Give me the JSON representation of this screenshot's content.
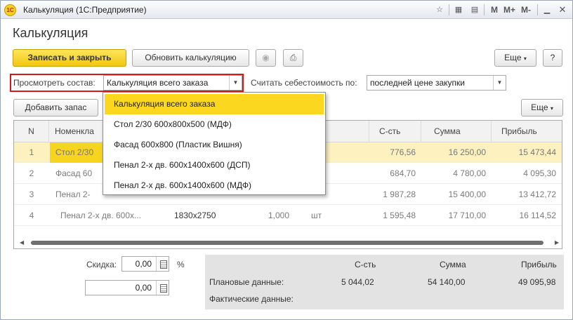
{
  "window": {
    "app_logo": "1С",
    "title": "Калькуляция  (1С:Предприятие)",
    "toolbar": {
      "m": "M",
      "mplus": "M+",
      "mminus": "M-"
    }
  },
  "form": {
    "title": "Калькуляция",
    "buttons": {
      "save_close": "Записать и закрыть",
      "refresh": "Обновить калькуляцию",
      "more": "Еще",
      "help": "?"
    },
    "view_label": "Просмотреть состав:",
    "view_value": "Калькуляция всего заказа",
    "cost_label": "Считать себестоимость по:",
    "cost_value": "последней цене закупки",
    "add_stock": "Добавить запас",
    "more2": "Еще"
  },
  "dropdown": {
    "items": [
      "Калькуляция всего заказа",
      "Стол 2/30 600х800х500 (МДФ)",
      "Фасад 600х800 (Пластик Вишня)",
      "Пенал 2-х дв. 600х1400х600 (ДСП)",
      "Пенал 2-х дв. 600х1400х600 (МДФ)"
    ]
  },
  "table": {
    "columns": {
      "n": "N",
      "name": "Номенкла",
      "cost": "С-сть",
      "sum": "Сумма",
      "profit": "Прибыль"
    },
    "rows": [
      {
        "n": "1",
        "name": "Стол 2/30",
        "size": "",
        "qty": "",
        "unit": "",
        "cost": "776,56",
        "sum": "16 250,00",
        "profit": "15 473,44"
      },
      {
        "n": "2",
        "name": "Фасад 60",
        "size": "",
        "qty": "",
        "unit": "",
        "cost": "684,70",
        "sum": "4 780,00",
        "profit": "4 095,30"
      },
      {
        "n": "3",
        "name": "Пенал 2-",
        "size": "",
        "qty": "",
        "unit": "",
        "cost": "1 987,28",
        "sum": "15 400,00",
        "profit": "13 412,72"
      },
      {
        "n": "4",
        "name": "Пенал 2-х дв. 600х...",
        "size": "1830х2750",
        "qty": "1,000",
        "unit": "шт",
        "cost": "1 595,48",
        "sum": "17 710,00",
        "profit": "16 114,52"
      }
    ]
  },
  "footer": {
    "discount_label": "Скидка:",
    "discount_value": "0,00",
    "percent": "%",
    "amount_value": "0,00",
    "headers": {
      "cost": "С-сть",
      "sum": "Сумма",
      "profit": "Прибыль"
    },
    "planned_label": "Плановые данные:",
    "planned": {
      "cost": "5 044,02",
      "sum": "54 140,00",
      "profit": "49 095,98"
    },
    "actual_label": "Фактические данные:"
  }
}
